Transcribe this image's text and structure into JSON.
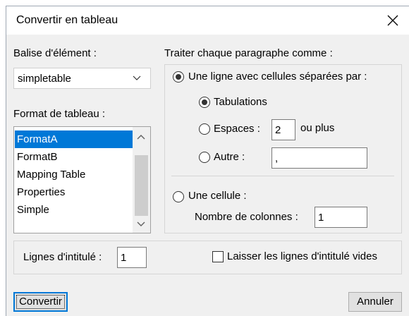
{
  "window": {
    "title": "Convertir en tableau"
  },
  "element_tag": {
    "label": "Balise d'élément :",
    "selected": "simpletable"
  },
  "table_format": {
    "label": "Format de tableau :",
    "items": [
      "FormatA",
      "FormatB",
      "Mapping Table",
      "Properties",
      "Simple"
    ],
    "selected_index": 0
  },
  "paragraph": {
    "label": "Traiter chaque paragraphe comme :",
    "option_row": "Une ligne avec cellules séparées par :",
    "tabs": "Tabulations",
    "spaces": "Espaces :",
    "spaces_value": "2",
    "or_more": "ou plus",
    "other": "Autre :",
    "other_value": ",",
    "option_cell": "Une cellule :",
    "columns_label": "Nombre de colonnes :",
    "columns_value": "1"
  },
  "header_rows": {
    "label": "Lignes d'intitulé :",
    "value": "1",
    "leave_empty": "Laisser les lignes d'intitulé vides",
    "leave_empty_checked": false
  },
  "buttons": {
    "convert": "Convertir",
    "cancel": "Annuler"
  },
  "icons": {
    "close": "close-icon",
    "dropdown": "chevron-down-icon",
    "scroll_up": "scroll-up-icon",
    "scroll_down": "scroll-down-icon"
  },
  "colors": {
    "selection": "#0078d7",
    "dialog_bg": "#f0f0f0"
  }
}
